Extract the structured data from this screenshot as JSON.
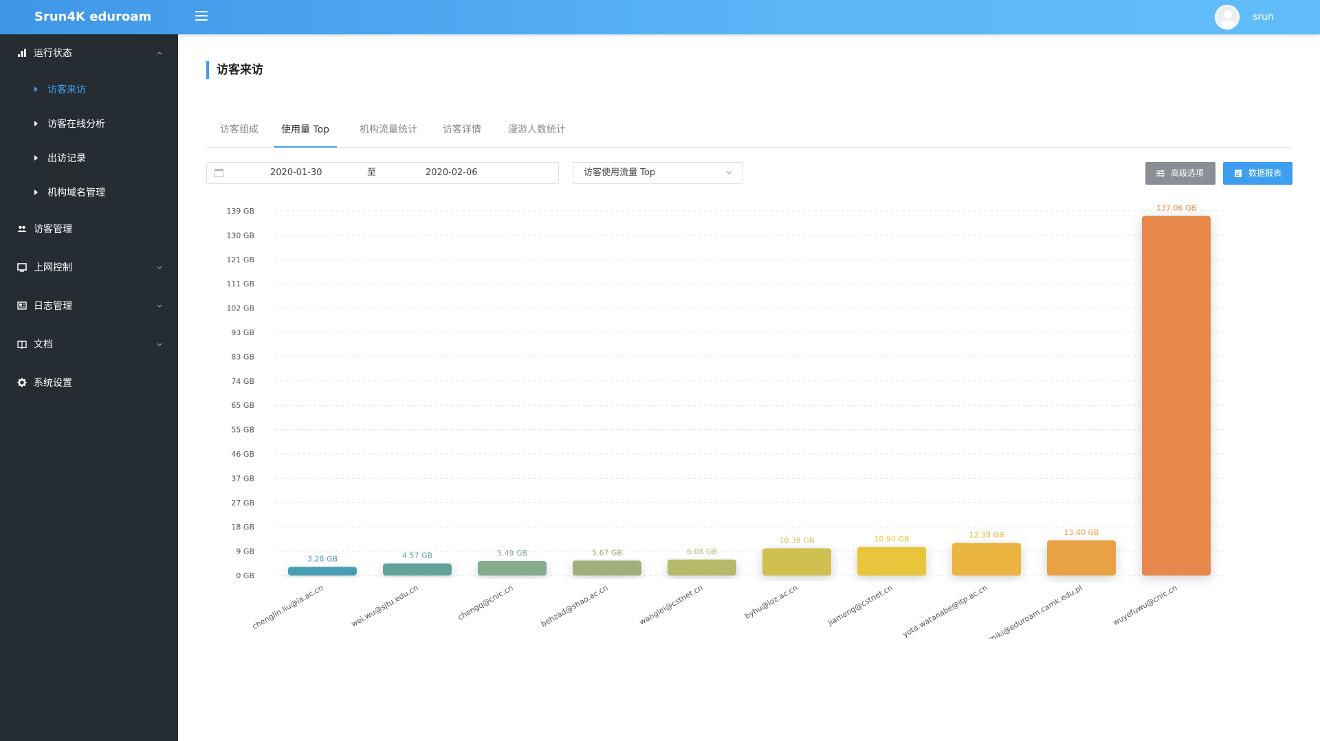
{
  "app": {
    "title": "Srun4K eduroam",
    "username": "srun"
  },
  "sidebar": {
    "items": [
      {
        "label": "运行状态",
        "icon": "bar-chart-icon",
        "expanded": true
      },
      {
        "label": "访客管理",
        "icon": "users-icon"
      },
      {
        "label": "上网控制",
        "icon": "monitor-icon",
        "expanded": false
      },
      {
        "label": "日志管理",
        "icon": "newspaper-icon",
        "expanded": false
      },
      {
        "label": "文档",
        "icon": "book-icon",
        "expanded": false
      },
      {
        "label": "系统设置",
        "icon": "gear-icon"
      }
    ],
    "subitems": [
      {
        "label": "访客来访",
        "active": true
      },
      {
        "label": "访客在线分析"
      },
      {
        "label": "出访记录"
      },
      {
        "label": "机构域名管理"
      }
    ]
  },
  "page": {
    "title": "访客来访"
  },
  "tabs": [
    "访客组成",
    "使用量 Top",
    "机构流量统计",
    "访客详情",
    "漫游人数统计"
  ],
  "active_tab": "使用量 Top",
  "filters": {
    "start_date": "2020-01-30",
    "separator": "至",
    "end_date": "2020-02-06",
    "metric": "访客使用流量 Top"
  },
  "buttons": {
    "advanced": "高级选项",
    "report": "数据报表"
  },
  "colors": {
    "accent": "#3e9ff0",
    "sidebar": "#252d33"
  },
  "chart_data": {
    "type": "bar",
    "categories": [
      "chenglin.liu@ia.ac.cn",
      "wei.wu@sjtu.edu.cn",
      "chengq@cnic.cn",
      "behzad@shao.ac.cn",
      "wanglei@cstnet.cn",
      "byhu@ioz.ac.cn",
      "jiameng@cstnet.cn",
      "yota.watanabe@itp.ac.cn",
      "miki@eduroam.camk.edu.pl",
      "wuyefuwu@cnic.cn"
    ],
    "values": [
      3.28,
      4.57,
      5.49,
      5.67,
      6.08,
      10.38,
      10.9,
      12.38,
      13.4,
      137.06
    ],
    "value_labels": [
      "3.28 GB",
      "4.57 GB",
      "5.49 GB",
      "5.67 GB",
      "6.08 GB",
      "10.38 GB",
      "10.90 GB",
      "12.38 GB",
      "13.40 GB",
      "137.06 GB"
    ],
    "bar_colors": [
      "#4a9db3",
      "#62a29a",
      "#84ab8b",
      "#9eb07a",
      "#b5b96a",
      "#d0c04f",
      "#e8c53b",
      "#e9b43f",
      "#e8a244",
      "#e6894c"
    ],
    "yticks": [
      "0 GB",
      "9 GB",
      "18 GB",
      "27 GB",
      "37 GB",
      "46 GB",
      "55 GB",
      "65 GB",
      "74 GB",
      "83 GB",
      "93 GB",
      "102 GB",
      "111 GB",
      "121 GB",
      "130 GB",
      "139 GB"
    ],
    "ylim": [
      0,
      139
    ],
    "grid": true,
    "xlabel": "",
    "ylabel": ""
  }
}
